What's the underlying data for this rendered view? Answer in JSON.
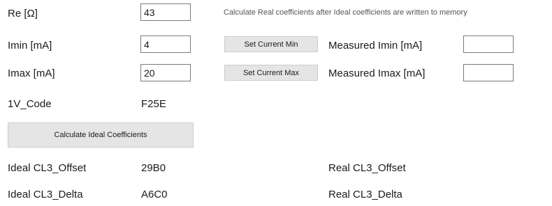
{
  "note": "Calculate Real coefficients after Ideal coefficients are written to memory",
  "fields": {
    "re": {
      "label": "Re [Ω]",
      "value": "43"
    },
    "imin": {
      "label": "Imin [mA]",
      "value": "4"
    },
    "imax": {
      "label": "Imax [mA]",
      "value": "20"
    },
    "code_1v": {
      "label": "1V_Code",
      "value": "F25E"
    }
  },
  "buttons": {
    "set_current_min": "Set Current Min",
    "set_current_max": "Set Current Max",
    "calculate_ideal": "Calculate Ideal Coefficients"
  },
  "measured": {
    "imin": {
      "label": "Measured Imin [mA]",
      "value": ""
    },
    "imax": {
      "label": "Measured Imax [mA]",
      "value": ""
    }
  },
  "ideal": {
    "offset": {
      "label": "Ideal CL3_Offset",
      "value": "29B0"
    },
    "delta": {
      "label": "Ideal CL3_Delta",
      "value": "A6C0"
    }
  },
  "real": {
    "offset": {
      "label": "Real CL3_Offset",
      "value": ""
    },
    "delta": {
      "label": "Real CL3_Delta",
      "value": ""
    }
  }
}
